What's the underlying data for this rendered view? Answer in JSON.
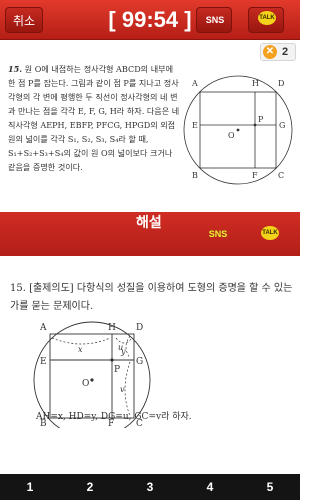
{
  "topbar": {
    "cancel_label": "취소",
    "timer": "[ 99:54 ]",
    "sns_label": "SNS",
    "talk_label": "TALK"
  },
  "score": {
    "icon": "x-badge-icon",
    "value": "2"
  },
  "problem": {
    "number": "15.",
    "text": "원 O에 내접하는 정사각형 ABCD의 내부에 한 점 P를 잡는다. 그림과 같이 점 P를 지나고 정사각형의 각 변에 평행한 두 직선이 정사각형의 네 변과 만나는 점을 각각 E, F, G, H라 하자. 다음은 네 직사각형 AEPH, EBFP, PFCG, HPGD의 외접원의 넓이를 각각 S₁, S₂, S₃, S₄라 할 때, S₁+S₂+S₃+S₄의 값이 원 O의 넓이보다 크거나 같음을 증명한 것이다.",
    "figure_labels": {
      "A": "A",
      "H": "H",
      "D": "D",
      "E": "E",
      "P": "P",
      "O": "O",
      "B": "B",
      "F": "F",
      "C": "C",
      "G": "G"
    }
  },
  "explain": {
    "label": "해설",
    "sns_label": "SNS",
    "talk_label": "TALK"
  },
  "solution": {
    "heading": "15. [출제의도] 다항식의 성질을 이용하여 도형의 증명을 할 수 있는가를 묻는 문제이다.",
    "figure_labels": {
      "A": "A",
      "H": "H",
      "D": "D",
      "E": "E",
      "P": "P",
      "O": "O",
      "B": "B",
      "F": "F",
      "C": "C",
      "G": "G",
      "x": "x",
      "y": "y",
      "u": "u",
      "v": "v"
    },
    "footer": "AH=x, HD=y, DG=u, GC=v라 하자."
  },
  "pager": {
    "items": [
      "1",
      "2",
      "3",
      "4",
      "5"
    ]
  },
  "colors": {
    "accent": "#c8261d",
    "pager_bg": "#141414",
    "badge": "#f3a11f"
  }
}
